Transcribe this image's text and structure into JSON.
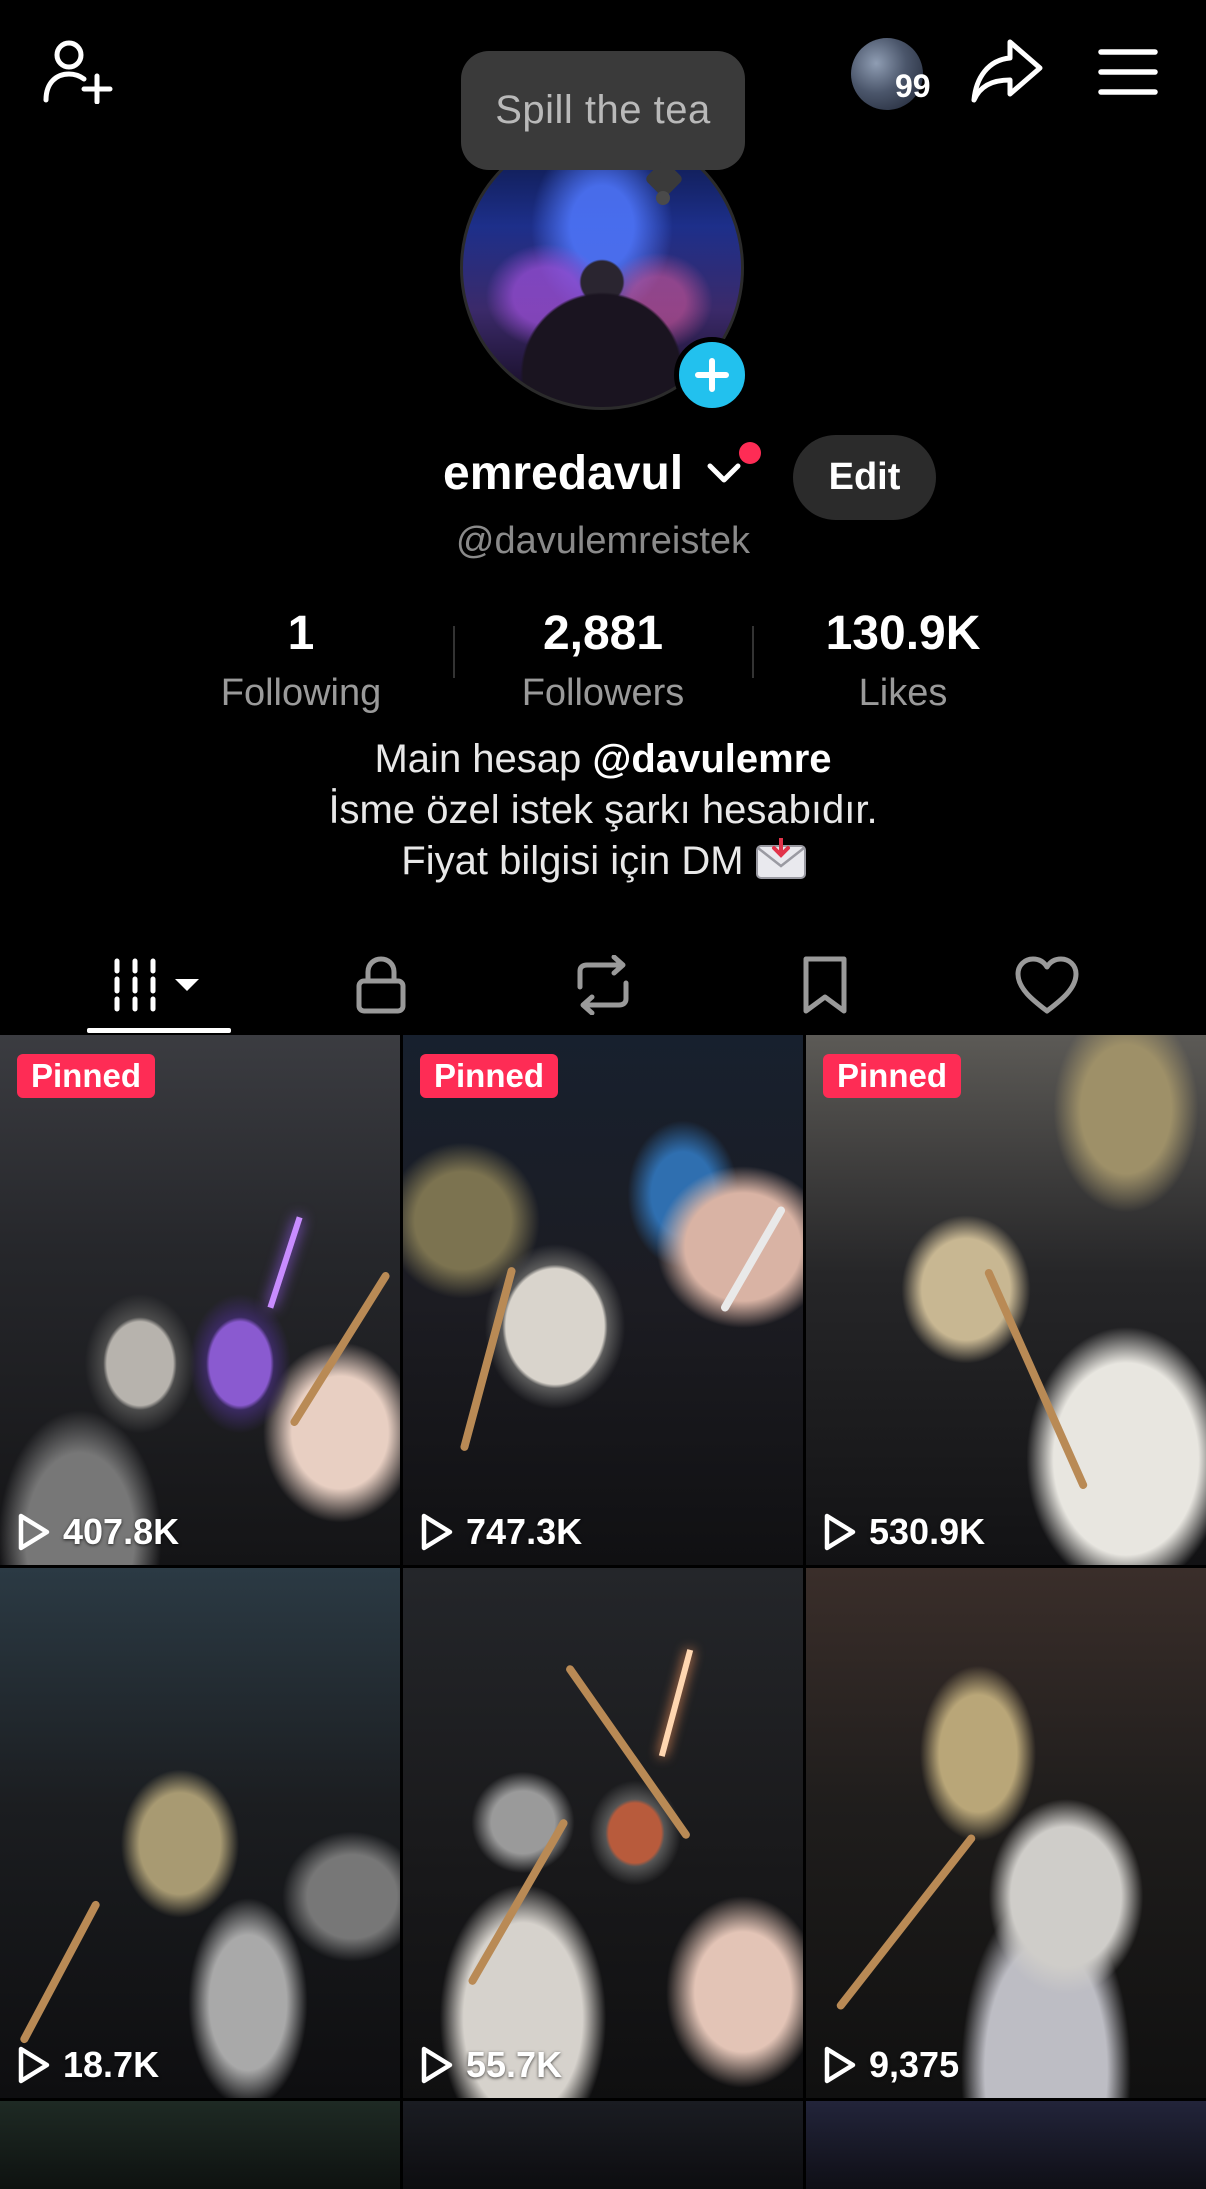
{
  "header": {
    "tooltip": "Spill the tea",
    "notification_count": "99"
  },
  "profile": {
    "display_name": "emredavul",
    "edit_label": "Edit",
    "handle": "@davulemreistek"
  },
  "stats": [
    {
      "value": "1",
      "label": "Following"
    },
    {
      "value": "2,881",
      "label": "Followers"
    },
    {
      "value": "130.9K",
      "label": "Likes"
    }
  ],
  "bio": {
    "line1_prefix": "Main hesap ",
    "line1_mention": "@davulemre",
    "line2": "İsme özel istek şarkı hesabıdır.",
    "line3": "Fiyat bilgisi için DM"
  },
  "tabs": [
    "videos-grid",
    "private",
    "reposts",
    "favorites",
    "liked"
  ],
  "videos": [
    {
      "pinned": "Pinned",
      "views": "407.8K"
    },
    {
      "pinned": "Pinned",
      "views": "747.3K"
    },
    {
      "pinned": "Pinned",
      "views": "530.9K"
    },
    {
      "views": "18.7K"
    },
    {
      "views": "55.7K"
    },
    {
      "views": "9,375"
    }
  ],
  "colors": {
    "background": "#000000",
    "accent_red": "#fe2c55",
    "accent_cyan": "#22c1ee",
    "secondary_text": "#9a9a9a"
  },
  "icons": [
    "add-friend-icon",
    "share-icon",
    "menu-icon",
    "plus-icon",
    "chevron-down-icon",
    "grid-icon",
    "lock-icon",
    "repost-icon",
    "bookmark-icon",
    "heart-icon",
    "play-icon",
    "envelope-icon"
  ]
}
